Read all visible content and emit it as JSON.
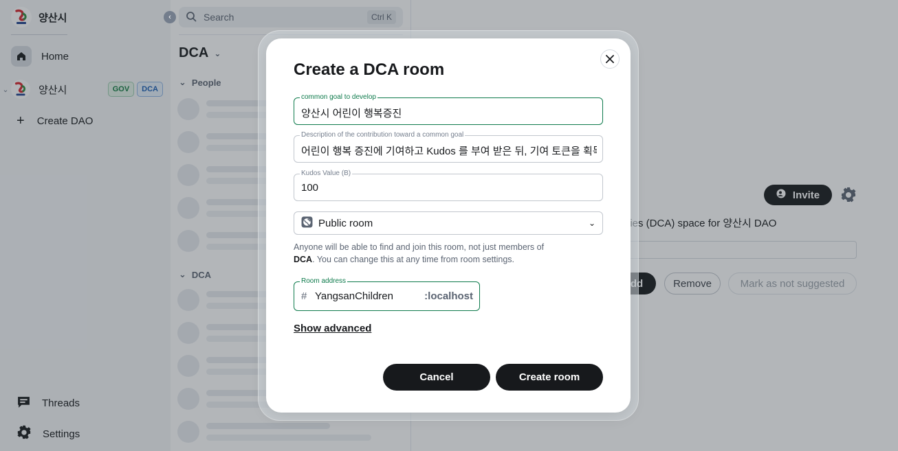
{
  "brand": {
    "name": "양산시"
  },
  "sidebar": {
    "home_label": "Home",
    "space": {
      "label": "양산시",
      "badges": [
        "GOV",
        "DCA"
      ]
    },
    "create_dao_label": "Create DAO",
    "threads_label": "Threads",
    "settings_label": "Settings"
  },
  "roomlist": {
    "search_placeholder": "Search",
    "search_shortcut": "Ctrl K",
    "space_title": "DCA",
    "section_people": "People",
    "section_dca": "DCA"
  },
  "main": {
    "invite_label": "Invite",
    "description": "ivities (DCA) space for 양산시 DAO",
    "add_label": "dd",
    "remove_label": "Remove",
    "mark_label": "Mark as not suggested"
  },
  "dialog": {
    "title": "Create a DCA room",
    "goal": {
      "label": "common goal to develop",
      "value": "양산시 어린이 행복증진"
    },
    "description": {
      "label": "Description of the contribution toward a common goal",
      "value": "어린이 행복 증진에 기여하고 Kudos 를 부여 받은 뒤, 기여 토큰을 획득"
    },
    "kudos": {
      "label": "Kudos Value (B)",
      "value": "100"
    },
    "visibility": {
      "selected": "Public room"
    },
    "help_prefix": "Anyone will be able to find and join this room, not just members of ",
    "help_space": "DCA",
    "help_suffix": ". You can change this at any time from room settings.",
    "address": {
      "label": "Room address",
      "prefix": "#",
      "alias": "YangsanChildren",
      "domain": ":localhost"
    },
    "show_advanced": "Show advanced",
    "cancel_label": "Cancel",
    "create_label": "Create room"
  },
  "colors": {
    "accent": "#0d7a4b",
    "primary_button": "#17191c",
    "gov_badge": "#0f7a3f",
    "dca_badge": "#1a5fb4"
  },
  "icons": [
    "home-icon",
    "plus-icon",
    "threads-icon",
    "settings-icon",
    "search-icon",
    "globe-icon",
    "close-icon",
    "chevron-down-icon",
    "invite-icon",
    "gear-icon"
  ]
}
